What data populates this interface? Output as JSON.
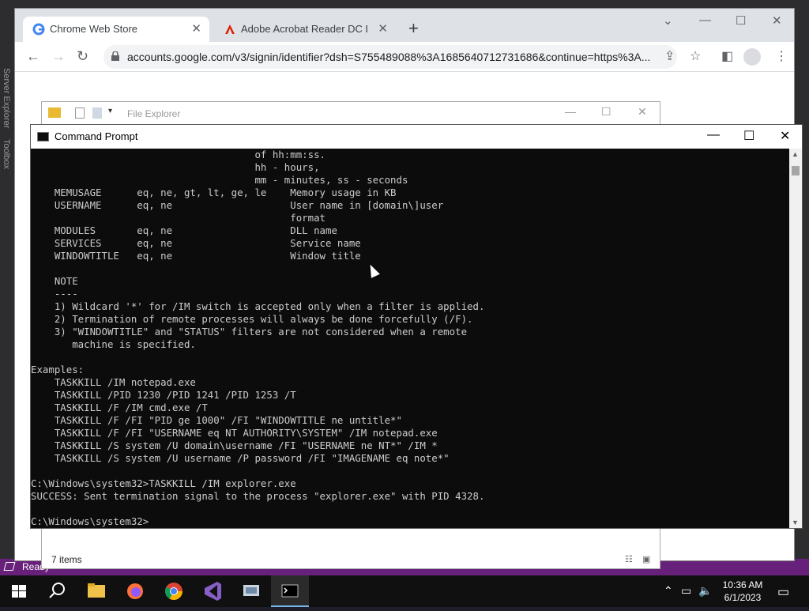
{
  "vs": {
    "side_labels": [
      "Server Explorer",
      "Toolbox"
    ],
    "status_text": "Ready"
  },
  "chrome": {
    "tabs": [
      {
        "label": "Chrome Web Store",
        "active": true
      },
      {
        "label": "Adobe Acrobat Reader DC Down",
        "active": false
      }
    ],
    "url": "accounts.google.com/v3/signin/identifier?dsh=S755489088%3A1685640712731686&continue=https%3A..."
  },
  "explorer": {
    "title": "File Explorer",
    "status_items": "7 items"
  },
  "cmd": {
    "title": "Command Prompt",
    "lines": [
      "                                      of hh:mm:ss.",
      "                                      hh - hours,",
      "                                      mm - minutes, ss - seconds",
      "    MEMUSAGE      eq, ne, gt, lt, ge, le    Memory usage in KB",
      "    USERNAME      eq, ne                    User name in [domain\\]user",
      "                                            format",
      "    MODULES       eq, ne                    DLL name",
      "    SERVICES      eq, ne                    Service name",
      "    WINDOWTITLE   eq, ne                    Window title",
      "",
      "    NOTE",
      "    ----",
      "    1) Wildcard '*' for /IM switch is accepted only when a filter is applied.",
      "    2) Termination of remote processes will always be done forcefully (/F).",
      "    3) \"WINDOWTITLE\" and \"STATUS\" filters are not considered when a remote",
      "       machine is specified.",
      "",
      "Examples:",
      "    TASKKILL /IM notepad.exe",
      "    TASKKILL /PID 1230 /PID 1241 /PID 1253 /T",
      "    TASKKILL /F /IM cmd.exe /T",
      "    TASKKILL /F /FI \"PID ge 1000\" /FI \"WINDOWTITLE ne untitle*\"",
      "    TASKKILL /F /FI \"USERNAME eq NT AUTHORITY\\SYSTEM\" /IM notepad.exe",
      "    TASKKILL /S system /U domain\\username /FI \"USERNAME ne NT*\" /IM *",
      "    TASKKILL /S system /U username /P password /FI \"IMAGENAME eq note*\"",
      "",
      "C:\\Windows\\system32>TASKKILL /IM explorer.exe",
      "SUCCESS: Sent termination signal to the process \"explorer.exe\" with PID 4328.",
      "",
      "C:\\Windows\\system32>"
    ]
  },
  "taskbar": {
    "apps": [
      "start",
      "search",
      "file-explorer",
      "firefox",
      "chrome",
      "visual-studio",
      "network-app",
      "command-prompt"
    ],
    "time": "10:36 AM",
    "date": "6/1/2023"
  }
}
